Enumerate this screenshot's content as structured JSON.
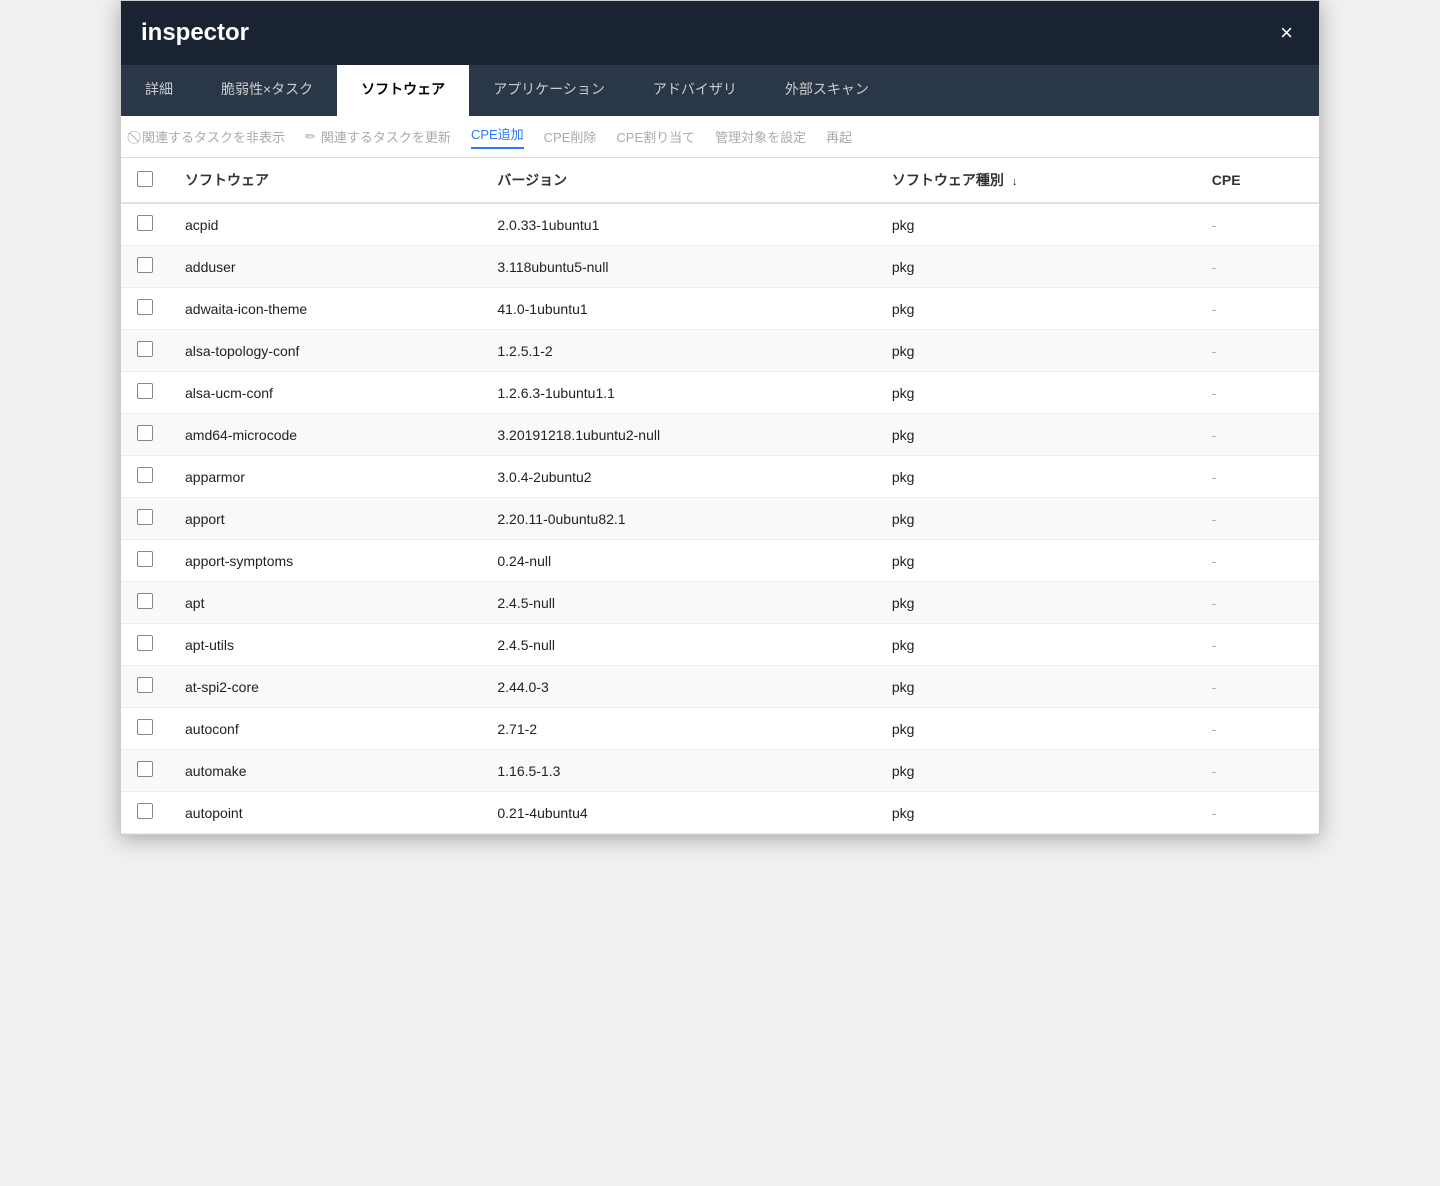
{
  "window": {
    "title": "inspector",
    "close_label": "×"
  },
  "tabs": [
    {
      "id": "details",
      "label": "詳細",
      "active": false
    },
    {
      "id": "vuln-tasks",
      "label": "脆弱性×タスク",
      "active": false
    },
    {
      "id": "software",
      "label": "ソフトウェア",
      "active": true
    },
    {
      "id": "applications",
      "label": "アプリケーション",
      "active": false
    },
    {
      "id": "advisory",
      "label": "アドバイザリ",
      "active": false
    },
    {
      "id": "external-scan",
      "label": "外部スキャン",
      "active": false
    }
  ],
  "toolbar": {
    "items": [
      {
        "id": "hide-related-tasks",
        "label": "関連するタスクを非表示",
        "icon": "hide-icon",
        "active": false,
        "disabled": true
      },
      {
        "id": "update-related-tasks",
        "label": "関連するタスクを更新",
        "icon": "edit-icon",
        "active": false,
        "disabled": true
      },
      {
        "id": "add-cpe",
        "label": "CPE追加",
        "active": true
      },
      {
        "id": "delete-cpe",
        "label": "CPE削除",
        "active": false
      },
      {
        "id": "assign-cpe",
        "label": "CPE割り当て",
        "active": false
      },
      {
        "id": "set-managed",
        "label": "管理対象を設定",
        "active": false
      },
      {
        "id": "restart",
        "label": "再起",
        "active": false
      }
    ]
  },
  "table": {
    "columns": [
      {
        "id": "checkbox",
        "label": ""
      },
      {
        "id": "software",
        "label": "ソフトウェア"
      },
      {
        "id": "version",
        "label": "バージョン"
      },
      {
        "id": "type",
        "label": "ソフトウェア種別",
        "sort": "↓"
      },
      {
        "id": "cpe",
        "label": "CPE"
      }
    ],
    "rows": [
      {
        "name": "acpid",
        "version": "2.0.33-1ubuntu1",
        "type": "pkg",
        "cpe": "-"
      },
      {
        "name": "adduser",
        "version": "3.118ubuntu5-null",
        "type": "pkg",
        "cpe": "-"
      },
      {
        "name": "adwaita-icon-theme",
        "version": "41.0-1ubuntu1",
        "type": "pkg",
        "cpe": "-"
      },
      {
        "name": "alsa-topology-conf",
        "version": "1.2.5.1-2",
        "type": "pkg",
        "cpe": "-"
      },
      {
        "name": "alsa-ucm-conf",
        "version": "1.2.6.3-1ubuntu1.1",
        "type": "pkg",
        "cpe": "-"
      },
      {
        "name": "amd64-microcode",
        "version": "3.20191218.1ubuntu2-null",
        "type": "pkg",
        "cpe": "-"
      },
      {
        "name": "apparmor",
        "version": "3.0.4-2ubuntu2",
        "type": "pkg",
        "cpe": "-"
      },
      {
        "name": "apport",
        "version": "2.20.11-0ubuntu82.1",
        "type": "pkg",
        "cpe": "-"
      },
      {
        "name": "apport-symptoms",
        "version": "0.24-null",
        "type": "pkg",
        "cpe": "-"
      },
      {
        "name": "apt",
        "version": "2.4.5-null",
        "type": "pkg",
        "cpe": "-"
      },
      {
        "name": "apt-utils",
        "version": "2.4.5-null",
        "type": "pkg",
        "cpe": "-"
      },
      {
        "name": "at-spi2-core",
        "version": "2.44.0-3",
        "type": "pkg",
        "cpe": "-"
      },
      {
        "name": "autoconf",
        "version": "2.71-2",
        "type": "pkg",
        "cpe": "-"
      },
      {
        "name": "automake",
        "version": "1.16.5-1.3",
        "type": "pkg",
        "cpe": "-"
      },
      {
        "name": "autopoint",
        "version": "0.21-4ubuntu4",
        "type": "pkg",
        "cpe": "-"
      }
    ]
  },
  "colors": {
    "title_bg": "#1a2332",
    "tab_bg": "#2a3748",
    "active_tab_bg": "#ffffff",
    "active_color": "#2979ff",
    "text_primary": "#222222",
    "text_secondary": "#aaaaaa"
  }
}
